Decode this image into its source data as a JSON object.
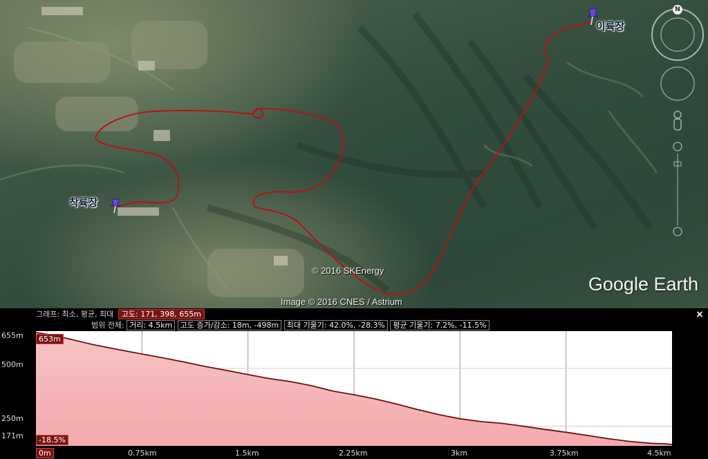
{
  "map": {
    "start_pin_label": "착륙장",
    "end_pin_label": "이륙장",
    "copyright_data": "© 2016 SKEnergy",
    "copyright_imagery": "Image © 2016 CNES / Astrium",
    "brand": "Google Earth",
    "compass_letter": "N"
  },
  "profile": {
    "close_label": "×",
    "graph_label": "그래프: 최소, 평균, 최대",
    "graph_values": "고도: 171, 398, 655m",
    "range_label": "범위 전체:",
    "distance": "거리: 4.5km",
    "elev_change": "고도 증가/감소: 18m, -498m",
    "max_slope": "최대 기울기: 42.0%, -28.3%",
    "avg_slope": "평균 기울기: 7.2%, -11.5%",
    "cursor_elev": "653m",
    "cursor_slope": "-18.5%",
    "cursor_dist": "0m",
    "colors": {
      "fill_top": "#f6c4c4",
      "fill_bottom": "#f4a9ae",
      "line": "#6b0f0f",
      "badge": "#7a1414"
    }
  },
  "chart_data": {
    "type": "area",
    "xlabel": "",
    "ylabel": "",
    "xlim": [
      0,
      4.5
    ],
    "ylim": [
      171,
      655
    ],
    "y_ticks": [
      "655m",
      "500m",
      "250m",
      "171m"
    ],
    "y_tick_values": [
      655,
      500,
      250,
      171
    ],
    "x_ticks": [
      "0m",
      "0.75km",
      "1.5km",
      "2.25km",
      "3km",
      "3.75km",
      "4.5km"
    ],
    "x_tick_values": [
      0,
      0.75,
      1.5,
      2.25,
      3,
      3.75,
      4.5
    ],
    "grid": true,
    "series": [
      {
        "x": [
          0,
          0.1,
          0.25,
          0.4,
          0.55,
          0.75,
          0.9,
          1.05,
          1.2,
          1.35,
          1.5,
          1.65,
          1.8,
          1.95,
          2.1,
          2.25,
          2.4,
          2.55,
          2.7,
          2.85,
          3.0,
          3.15,
          3.3,
          3.45,
          3.6,
          3.75,
          3.9,
          4.05,
          4.2,
          4.35,
          4.45,
          4.5
        ],
        "y": [
          655,
          645,
          625,
          603,
          585,
          562,
          545,
          527,
          508,
          491,
          473,
          456,
          443,
          425,
          402,
          386,
          368,
          346,
          322,
          300,
          282,
          270,
          262,
          250,
          236,
          224,
          210,
          196,
          184,
          176,
          174,
          171
        ]
      }
    ]
  }
}
